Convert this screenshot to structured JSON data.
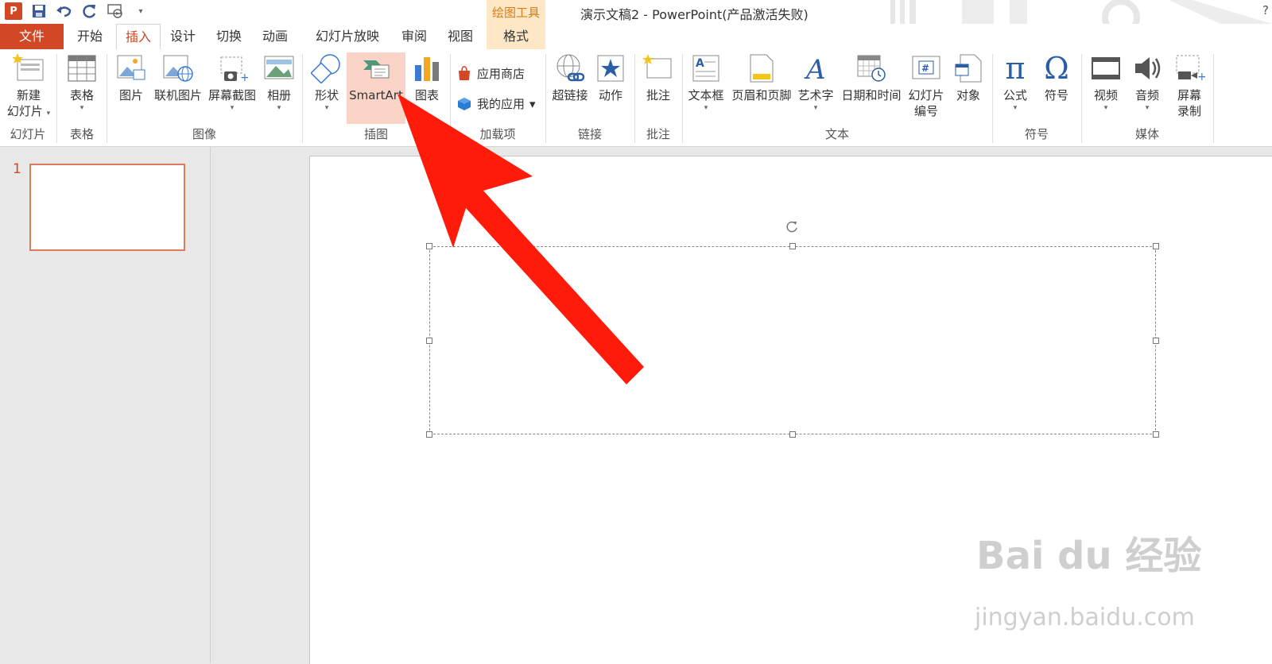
{
  "window": {
    "title": "演示文稿2 - PowerPoint(产品激活失败)",
    "context_group": "绘图工具",
    "help": "?"
  },
  "quick_access": {
    "app_logo": "P",
    "icons": [
      "save-icon",
      "undo-icon",
      "redo-icon",
      "presentation-icon",
      "customize-icon"
    ]
  },
  "tabs": {
    "file": "文件",
    "home": "开始",
    "insert": "插入",
    "design": "设计",
    "transitions": "切换",
    "animations": "动画",
    "slideshow": "幻灯片放映",
    "review": "审阅",
    "view": "视图",
    "format": "格式"
  },
  "ribbon": {
    "slides": {
      "new_slide": "新建",
      "new_slide2": "幻灯片",
      "label": "幻灯片"
    },
    "tables": {
      "table": "表格",
      "label": "表格"
    },
    "images": {
      "picture": "图片",
      "online_picture": "联机图片",
      "screenshot": "屏幕截图",
      "album": "相册",
      "label": "图像"
    },
    "illustrations": {
      "shapes": "形状",
      "smartart": "SmartArt",
      "chart": "图表",
      "label": "插图"
    },
    "addins": {
      "store": "应用商店",
      "my_apps": "我的应用",
      "label": "加载项"
    },
    "links": {
      "hyperlink": "超链接",
      "action": "动作",
      "label": "链接"
    },
    "comments": {
      "comment": "批注",
      "label": "批注"
    },
    "text": {
      "textbox": "文本框",
      "header_footer": "页眉和页脚",
      "wordart": "艺术字",
      "datetime": "日期和时间",
      "slide_number": "幻灯片",
      "slide_number2": "编号",
      "object": "对象",
      "label": "文本"
    },
    "symbols": {
      "equation": "公式",
      "symbol": "符号",
      "label": "符号",
      "pi": "π",
      "omega": "Ω"
    },
    "media": {
      "video": "视频",
      "audio": "音频",
      "screen_record": "屏幕",
      "screen_record2": "录制",
      "label": "媒体"
    }
  },
  "slides_panel": {
    "slide_number": "1"
  },
  "watermark": {
    "brand": "Bai du 经验",
    "url": "jingyan.baidu.com"
  },
  "colors": {
    "accent": "#d24726",
    "context": "#fde7c4",
    "highlight": "#fbd4c8",
    "arrow": "#ff1a0a"
  }
}
